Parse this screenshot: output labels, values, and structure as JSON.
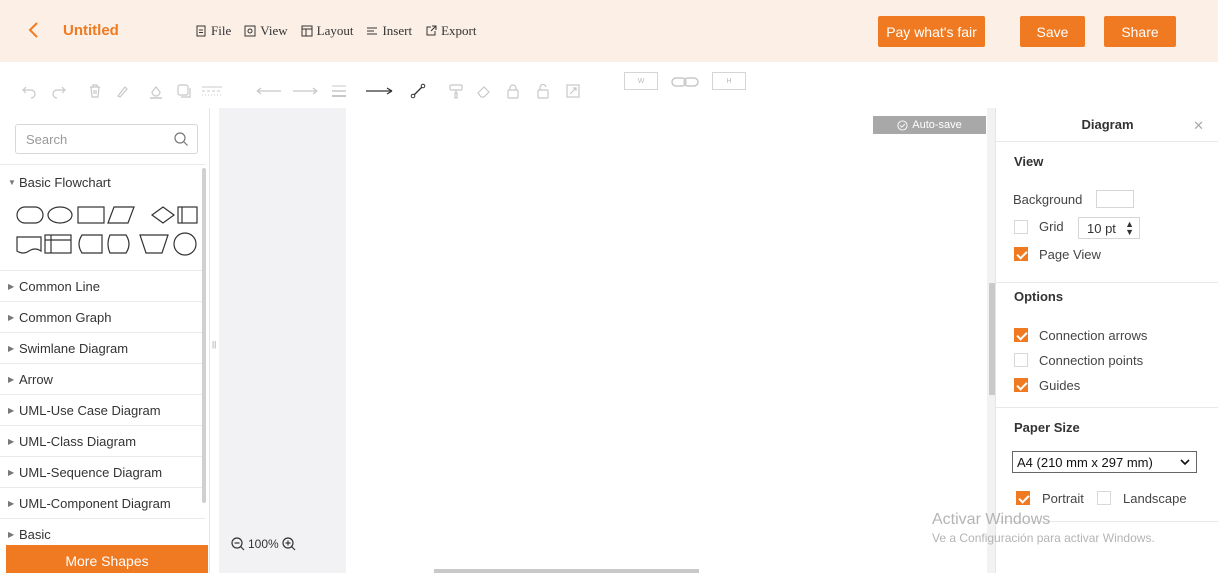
{
  "header": {
    "back_icon": "chevron-left-icon",
    "title": "Untitled",
    "menu": [
      {
        "label": "File",
        "icon": "file-icon"
      },
      {
        "label": "View",
        "icon": "view-icon"
      },
      {
        "label": "Layout",
        "icon": "layout-icon"
      },
      {
        "label": "Insert",
        "icon": "insert-icon"
      },
      {
        "label": "Export",
        "icon": "export-icon"
      }
    ],
    "pay_label": "Pay what's fair",
    "save_label": "Save",
    "share_label": "Share",
    "accent": "#f07a21",
    "background": "#fcefe6"
  },
  "toolbar": {
    "icons": [
      "undo-icon",
      "redo-icon",
      "delete-icon",
      "format-icon",
      "fill-color-icon",
      "shadow-icon",
      "line-style-icon",
      "line-start-icon",
      "line-end-icon",
      "line-width-icon",
      "connector-icon",
      "waypoint-icon",
      "format-painter-icon",
      "eraser-icon",
      "lock-icon",
      "unlock-icon",
      "fit-icon",
      "link-icon"
    ],
    "width_placeholder": "W",
    "height_placeholder": "H"
  },
  "left_panel": {
    "search_placeholder": "Search",
    "basic_flowchart": "Basic Flowchart",
    "sections": [
      "Common Line",
      "Common Graph",
      "Swimlane Diagram",
      "Arrow",
      "UML-Use Case Diagram",
      "UML-Class Diagram",
      "UML-Sequence Diagram",
      "UML-Component Diagram",
      "Basic"
    ],
    "more_shapes": "More Shapes"
  },
  "canvas": {
    "autosave": "Auto-save",
    "zoom": "100%"
  },
  "right_panel": {
    "title": "Diagram",
    "view": {
      "heading": "View",
      "background_label": "Background",
      "grid_label": "Grid",
      "grid_checked": false,
      "grid_size": "10 pt",
      "page_view_label": "Page View",
      "page_view_checked": true
    },
    "options": {
      "heading": "Options",
      "connection_arrows": "Connection arrows",
      "connection_arrows_checked": true,
      "connection_points": "Connection points",
      "connection_points_checked": false,
      "guides": "Guides",
      "guides_checked": true
    },
    "paper": {
      "heading": "Paper Size",
      "selected": "A4 (210 mm x 297 mm)",
      "portrait": "Portrait",
      "portrait_checked": true,
      "landscape": "Landscape",
      "landscape_checked": false
    }
  },
  "watermark": {
    "line1": "Activar Windows",
    "line2": "Ve a Configuración para activar Windows."
  }
}
